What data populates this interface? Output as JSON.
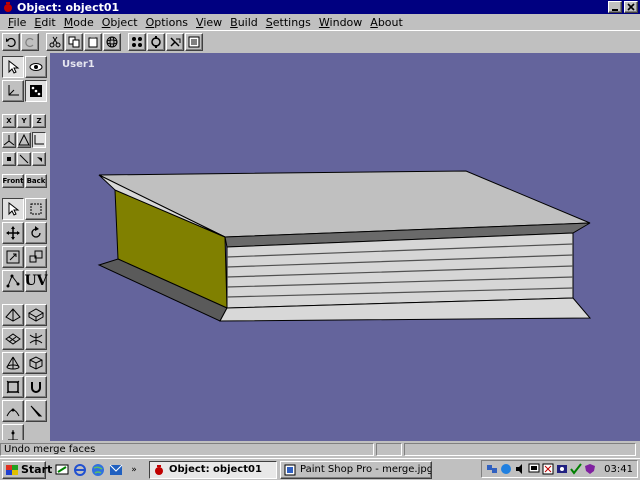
{
  "window": {
    "title": "Object: object01",
    "app_icon": "teapot-icon"
  },
  "menu": [
    "File",
    "Edit",
    "Mode",
    "Object",
    "Options",
    "View",
    "Build",
    "Settings",
    "Window",
    "About"
  ],
  "toolbar_icons": [
    "undo-icon",
    "redo-icon",
    "cut-icon",
    "copy-icon",
    "paste-icon",
    "sphere-icon",
    "points-icon",
    "rotate-view-icon",
    "move-view-icon",
    "properties-icon"
  ],
  "palette": {
    "axis_x": "X",
    "axis_y": "Y",
    "axis_z": "Z",
    "front_label": "Front",
    "back_label": "Back",
    "uv_label": "UV"
  },
  "viewport": {
    "label": "User1",
    "background": "#64649c"
  },
  "model": {
    "top_color": "#c0c0c0",
    "side_color": "#808000",
    "pages_color": "#d4d4d4",
    "cover_color": "#5a5a5a"
  },
  "status": {
    "message": "Undo merge faces"
  },
  "taskbar": {
    "start": "Start",
    "quick_launch_more": "»",
    "tasks": [
      {
        "label": "Object: object01",
        "active": true
      },
      {
        "label": "Paint Shop Pro - merge.jpg",
        "active": false
      }
    ],
    "clock": "03:41"
  }
}
